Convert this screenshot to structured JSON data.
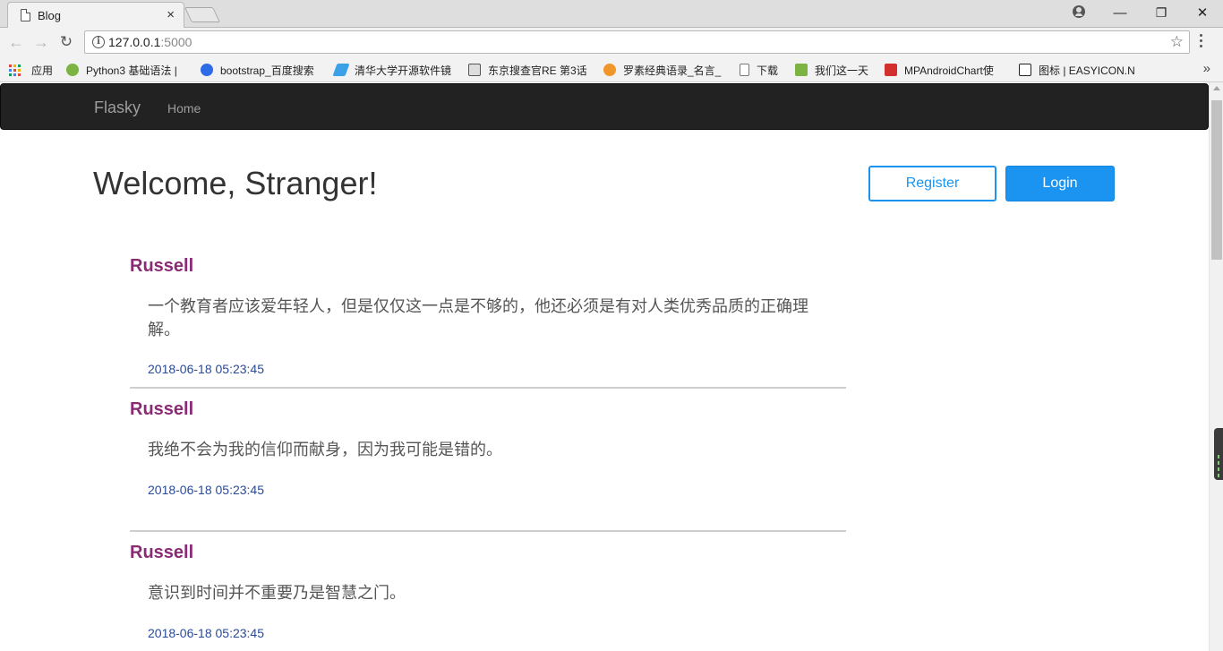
{
  "browser": {
    "tab_title": "Blog",
    "tab_close": "×",
    "window_controls": {
      "minimize": "—",
      "maximize": "❐",
      "close": "✕"
    },
    "url_host": "127.0.0.1",
    "url_port": ":5000",
    "star": "☆",
    "nav": {
      "back": "←",
      "forward": "→",
      "reload": "↻"
    },
    "bookmarks": [
      {
        "label": "应用",
        "icon": "apps-grid-icon",
        "color": "#e8453c"
      },
      {
        "label": "Python3 基础语法 |",
        "icon": "runoob-icon",
        "color": "#7cb342"
      },
      {
        "label": "bootstrap_百度搜索",
        "icon": "baidu-paw-icon",
        "color": "#2e6be6"
      },
      {
        "label": "清华大学开源软件镜",
        "icon": "tuna-icon",
        "color": "#3aa0e8"
      },
      {
        "label": "东京搜查官RE 第3话",
        "icon": "bilibili-face-icon",
        "color": "#555555"
      },
      {
        "label": "罗素经典语录_名言_",
        "icon": "juzi-icon",
        "color": "#f0962b"
      },
      {
        "label": "下载",
        "icon": "page-icon",
        "color": "#888888"
      },
      {
        "label": "我们这一天",
        "icon": "iqiyi-icon",
        "color": "#7cb342"
      },
      {
        "label": "MPAndroidChart使",
        "icon": "csdn-icon",
        "color": "#d32f2f"
      },
      {
        "label": "图标 | EASYICON.N",
        "icon": "easyicon-icon",
        "color": "#222222"
      }
    ],
    "bookmarks_more": "»"
  },
  "navbar": {
    "brand": "Flasky",
    "links": [
      "Home"
    ]
  },
  "header": {
    "title": "Welcome, Stranger!",
    "register_label": "Register",
    "login_label": "Login"
  },
  "posts": [
    {
      "author": "Russell",
      "body": "一个教育者应该爱年轻人，但是仅仅这一点是不够的，他还必须是有对人类优秀品质的正确理解。",
      "timestamp": "2018-06-18 05:23:45"
    },
    {
      "author": "Russell",
      "body": "我绝不会为我的信仰而献身，因为我可能是错的。",
      "timestamp": "2018-06-18 05:23:45"
    },
    {
      "author": "Russell",
      "body": "意识到时间并不重要乃是智慧之门。",
      "timestamp": "2018-06-18 05:23:45"
    }
  ],
  "colors": {
    "navbar_bg": "#222222",
    "brand_text": "#9d9d9d",
    "primary": "#1a94f0",
    "author": "#8b2a75",
    "timestamp": "#2a4b9a"
  }
}
